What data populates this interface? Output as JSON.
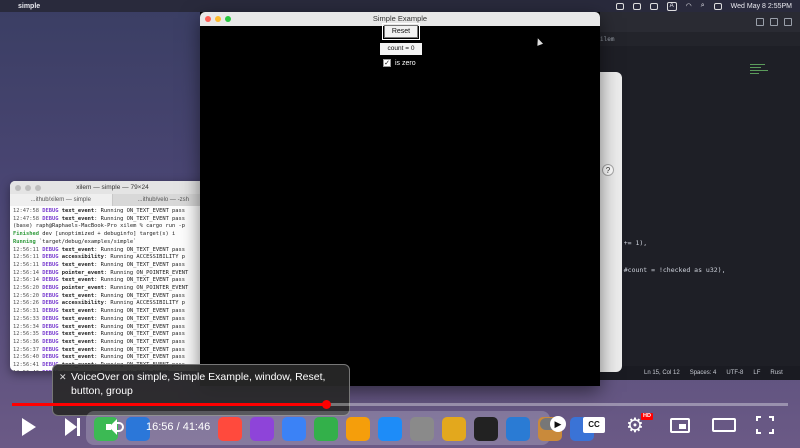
{
  "menubar": {
    "app_name": "simple",
    "date_time": "Wed May 8  2:55PM",
    "a_indicator": "A"
  },
  "editor": {
    "path_fragment": "ilem",
    "code_lines": [
      "{",
      "",
      "",
      "",
      "nt += 1),",
      "d) #count = !checked as u32),"
    ],
    "status": {
      "position": "Ln 15, Col 12",
      "spaces": "Spaces: 4",
      "encoding": "UTF-8",
      "eol": "LF",
      "language": "Rust"
    }
  },
  "dialog": {
    "help": "?"
  },
  "terminal": {
    "title": "xilem — simple — 79×24",
    "tabs": [
      "...ithub/xilem — simple",
      "...ithub/velo — -zsh"
    ],
    "lines": [
      {
        "ts": "12:47:58",
        "lvl": "DEBUG",
        "ev": "text_event",
        "msg": ": Running ON_TEXT_EVENT pass"
      },
      {
        "ts": "12:47:58",
        "lvl": "DEBUG",
        "ev": "text_event",
        "msg": ": Running ON_TEXT_EVENT pass"
      },
      {
        "plain": "(base) raph@Raphaels-MacBook-Pro xilem % cargo run -p"
      },
      {
        "green": "    Finished",
        "plain": " dev [unoptimized + debuginfo] target(s) i"
      },
      {
        "green": "     Running",
        "plain": " `target/debug/examples/simple`"
      },
      {
        "ts": "12:56:11",
        "lvl": "DEBUG",
        "ev": "text_event",
        "msg": ": Running ON_TEXT_EVENT pass"
      },
      {
        "ts": "12:56:11",
        "lvl": "DEBUG",
        "ev": "accessibility",
        "msg": ": Running ACCESSIBILITY p"
      },
      {
        "ts": "12:56:11",
        "lvl": "DEBUG",
        "ev": "text_event",
        "msg": ": Running ON_TEXT_EVENT pass"
      },
      {
        "ts": "12:56:14",
        "lvl": "DEBUG",
        "ev": "pointer_event",
        "msg": ": Running ON_POINTER_EVENT"
      },
      {
        "ts": "12:56:14",
        "lvl": "DEBUG",
        "ev": "text_event",
        "msg": ": Running ON_TEXT_EVENT pass"
      },
      {
        "ts": "12:56:20",
        "lvl": "DEBUG",
        "ev": "pointer_event",
        "msg": ": Running ON_POINTER_EVENT"
      },
      {
        "ts": "12:56:20",
        "lvl": "DEBUG",
        "ev": "text_event",
        "msg": ": Running ON_TEXT_EVENT pass"
      },
      {
        "ts": "12:56:26",
        "lvl": "DEBUG",
        "ev": "accessibility",
        "msg": ": Running ACCESSIBILITY p"
      },
      {
        "ts": "12:56:31",
        "lvl": "DEBUG",
        "ev": "text_event",
        "msg": ": Running ON_TEXT_EVENT pass"
      },
      {
        "ts": "12:56:33",
        "lvl": "DEBUG",
        "ev": "text_event",
        "msg": ": Running ON_TEXT_EVENT pass"
      },
      {
        "ts": "12:56:34",
        "lvl": "DEBUG",
        "ev": "text_event",
        "msg": ": Running ON_TEXT_EVENT pass"
      },
      {
        "ts": "12:56:35",
        "lvl": "DEBUG",
        "ev": "text_event",
        "msg": ": Running ON_TEXT_EVENT pass"
      },
      {
        "ts": "12:56:36",
        "lvl": "DEBUG",
        "ev": "text_event",
        "msg": ": Running ON_TEXT_EVENT pass"
      },
      {
        "ts": "12:56:37",
        "lvl": "DEBUG",
        "ev": "text_event",
        "msg": ": Running ON_TEXT_EVENT pass"
      },
      {
        "ts": "12:56:40",
        "lvl": "DEBUG",
        "ev": "text_event",
        "msg": ": Running ON_TEXT_EVENT pass"
      },
      {
        "ts": "12:56:41",
        "lvl": "DEBUG",
        "ev": "text_event",
        "msg": ": Running ON_TEXT_EVENT pass"
      },
      {
        "ts": "12:56:42",
        "lvl": "DEBUG",
        "ev": "text_event",
        "msg": ": Running ON_TEXT_EVENT pass"
      }
    ]
  },
  "simple_window": {
    "title": "Simple Example",
    "reset_label": "Reset",
    "count_label": "count = 0",
    "zero_label": "is zero",
    "checkbox_mark": "✓"
  },
  "voiceover": {
    "close": "✕",
    "text": "VoiceOver on simple, Simple Example, window, Reset, button, group"
  },
  "player": {
    "current_time": "16:56",
    "total_time": "41:46",
    "time_display": "16:56 / 41:46",
    "progress_fraction": 0.405,
    "cc_label": "CC",
    "hd_label": "HD",
    "progress_color": "#ff0000"
  },
  "dock_apps": [
    {
      "name": "facetime",
      "color": "#3cba54"
    },
    {
      "name": "safari",
      "color": "#2b77d9"
    },
    {
      "name": "calendar",
      "color": "#ff4a3d"
    },
    {
      "name": "podcasts",
      "color": "#8e44d9"
    },
    {
      "name": "keynote",
      "color": "#3b82f6"
    },
    {
      "name": "numbers",
      "color": "#33b04a"
    },
    {
      "name": "pages",
      "color": "#f59e0b"
    },
    {
      "name": "appstore",
      "color": "#1d8cf8"
    },
    {
      "name": "settings",
      "color": "#8a8a8a"
    },
    {
      "name": "chrome",
      "color": "#e3a81d"
    },
    {
      "name": "terminal",
      "color": "#222222"
    },
    {
      "name": "vscode",
      "color": "#2a7bd4"
    },
    {
      "name": "monitor",
      "color": "#c98a3b"
    },
    {
      "name": "xcode",
      "color": "#3a73d6"
    }
  ]
}
